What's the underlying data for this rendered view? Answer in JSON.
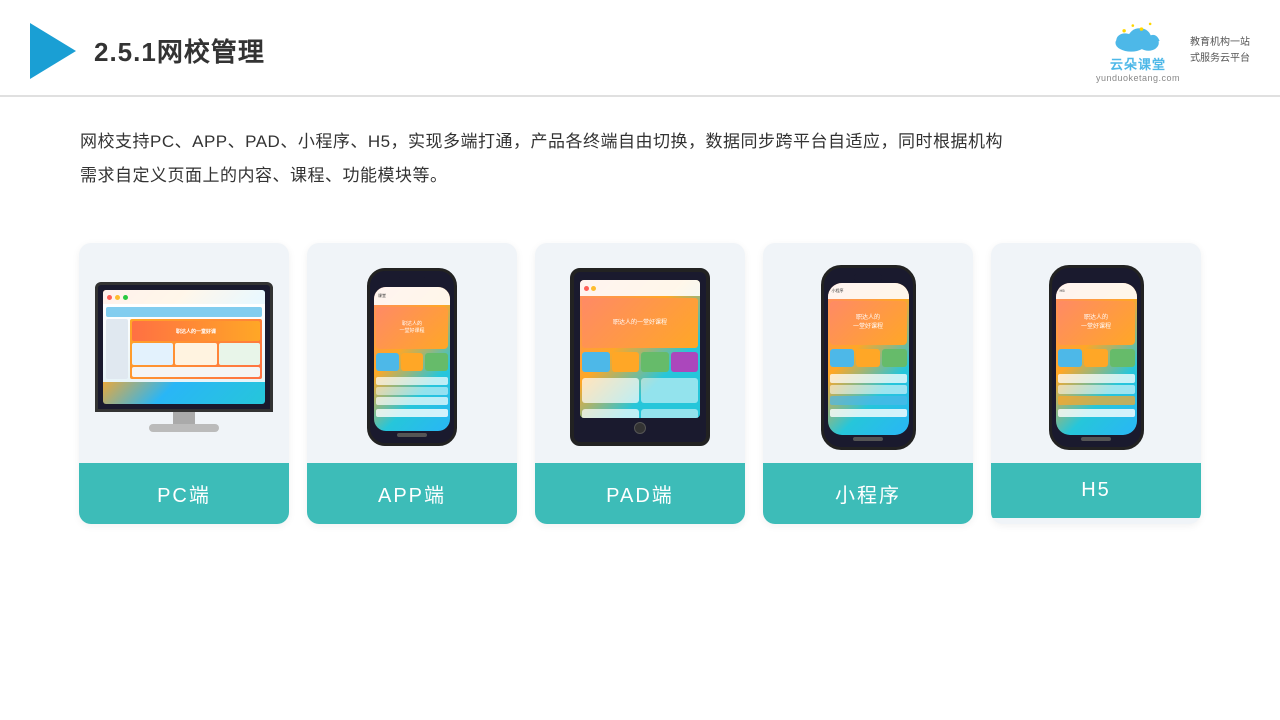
{
  "header": {
    "title": "2.5.1网校管理",
    "brand": {
      "name": "云朵课堂",
      "url": "yunduoketang.com",
      "tagline": "教育机构一站\n式服务云平台"
    }
  },
  "description": {
    "text1": "网校支持PC、APP、PAD、小程序、H5，实现多端打通，产品各终端自由切换，数据同步跨平台自适应，同时根据机构",
    "text2": "需求自定义页面上的内容、课程、功能模块等。"
  },
  "cards": [
    {
      "id": "pc",
      "label": "PC端"
    },
    {
      "id": "app",
      "label": "APP端"
    },
    {
      "id": "pad",
      "label": "PAD端"
    },
    {
      "id": "miniprogram",
      "label": "小程序"
    },
    {
      "id": "h5",
      "label": "H5"
    }
  ],
  "colors": {
    "accent": "#3dbcb8",
    "header_border": "#e0e0e0",
    "card_bg": "#f0f4f8",
    "title_color": "#333333"
  }
}
